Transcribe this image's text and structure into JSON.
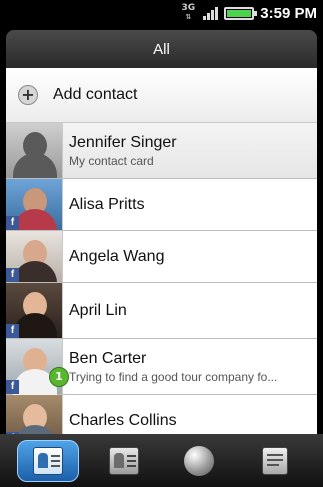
{
  "status_bar": {
    "network_label": "3G",
    "time": "3:59 PM",
    "battery_color": "#4bd34b"
  },
  "header": {
    "title": "All"
  },
  "add_contact": {
    "label": "Add contact",
    "icon": "plus-icon"
  },
  "contacts": [
    {
      "name": "Jennifer Singer",
      "subtitle": "My contact card",
      "avatar": "default-silhouette",
      "facebook": false
    },
    {
      "name": "Alisa Pritts",
      "subtitle": "",
      "avatar": "photo",
      "facebook": true
    },
    {
      "name": "Angela Wang",
      "subtitle": "",
      "avatar": "photo",
      "facebook": true
    },
    {
      "name": "April  Lin",
      "subtitle": "",
      "avatar": "photo",
      "facebook": true
    },
    {
      "name": "Ben  Carter",
      "subtitle": "Trying to find a good tour company fo...",
      "avatar": "photo",
      "facebook": true,
      "badge": "1"
    },
    {
      "name": "Charles  Collins",
      "subtitle": "",
      "avatar": "photo",
      "facebook": true
    }
  ],
  "tabs": [
    {
      "name": "contacts-tab",
      "icon": "people-card-icon",
      "active": true
    },
    {
      "name": "groups-tab",
      "icon": "group-cards-icon",
      "active": false
    },
    {
      "name": "online-directories-tab",
      "icon": "globe-icon",
      "active": false
    },
    {
      "name": "call-history-tab",
      "icon": "phone-log-icon",
      "active": false
    }
  ],
  "colors": {
    "accent": "#3b8fd8",
    "facebook": "#3b5998",
    "notification": "#5ab52f"
  }
}
